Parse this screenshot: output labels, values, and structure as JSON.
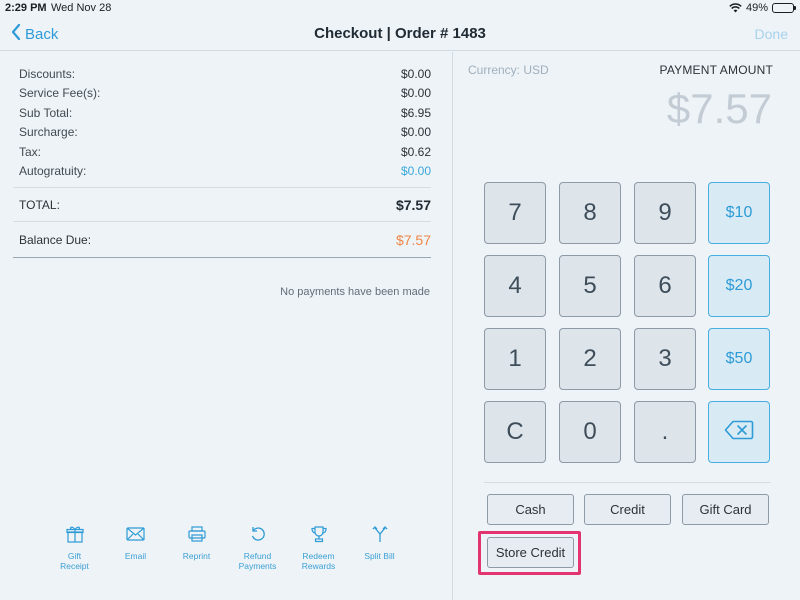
{
  "status_bar": {
    "time": "2:29 PM",
    "date": "Wed Nov 28",
    "battery": "49%",
    "battery_level": 0.49
  },
  "nav": {
    "back_label": "Back",
    "title": "Checkout | Order # 1483",
    "done_label": "Done"
  },
  "summary": {
    "rows": [
      {
        "label": "Discounts:",
        "value": "$0.00"
      },
      {
        "label": "Service Fee(s):",
        "value": "$0.00"
      },
      {
        "label": "Sub Total:",
        "value": "$6.95"
      },
      {
        "label": "Surcharge:",
        "value": "$0.00"
      },
      {
        "label": "Tax:",
        "value": "$0.62"
      },
      {
        "label": "Autogratuity:",
        "value": "$0.00"
      }
    ],
    "total_label": "TOTAL:",
    "total_value": "$7.57",
    "balance_label": "Balance Due:",
    "balance_value": "$7.57"
  },
  "payments_message": "No payments have been made",
  "actions": [
    {
      "label": "Gift\nReceipt",
      "icon": "gift-icon"
    },
    {
      "label": "Email",
      "icon": "envelope-icon"
    },
    {
      "label": "Reprint",
      "icon": "printer-icon"
    },
    {
      "label": "Refund\nPayments",
      "icon": "undo-icon"
    },
    {
      "label": "Redeem\nRewards",
      "icon": "trophy-icon"
    },
    {
      "label": "Split Bill",
      "icon": "split-icon"
    }
  ],
  "payment": {
    "currency": "Currency: USD",
    "amount_label": "PAYMENT AMOUNT",
    "amount": "$7.57"
  },
  "keypad": {
    "keys": [
      "7",
      "8",
      "9",
      "4",
      "5",
      "6",
      "1",
      "2",
      "3",
      "C",
      "0",
      "."
    ],
    "quick_amounts": [
      "$10",
      "$20",
      "$50"
    ],
    "backspace_icon": "backspace-icon"
  },
  "tenders": {
    "cash": "Cash",
    "credit": "Credit",
    "gift_card": "Gift Card",
    "store_credit": "Store Credit"
  },
  "colors": {
    "accent": "#2e9bd6",
    "balance": "#ef8748",
    "highlight": "#e2346f"
  }
}
